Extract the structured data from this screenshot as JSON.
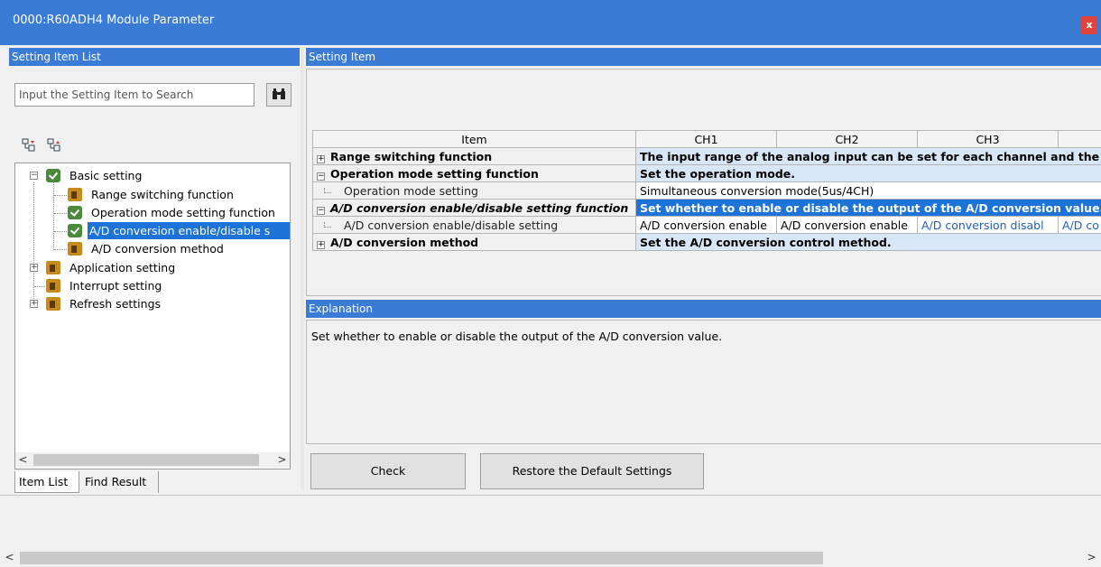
{
  "window": {
    "title": "0000:R60ADH4 Module Parameter",
    "close_label": "x"
  },
  "left_pane": {
    "header": "Setting Item List",
    "search_placeholder": "Input the Setting Item to Search",
    "search_icon": "binoculars-icon",
    "toolbar_icons": [
      "expand-all-icon",
      "collapse-all-icon"
    ],
    "tree": [
      {
        "label": "Basic setting",
        "icon": "check-icon",
        "expanded": true,
        "level": 0
      },
      {
        "label": "Range switching function",
        "icon": "module-icon",
        "level": 1
      },
      {
        "label": "Operation mode setting function",
        "icon": "check-icon",
        "level": 1
      },
      {
        "label": "A/D conversion enable/disable s",
        "icon": "check-icon",
        "level": 1,
        "selected": true
      },
      {
        "label": "A/D conversion method",
        "icon": "module-icon",
        "level": 1
      },
      {
        "label": "Application setting",
        "icon": "module-icon",
        "expanded": false,
        "level": 0
      },
      {
        "label": "Interrupt setting",
        "icon": "module-icon",
        "level": 0
      },
      {
        "label": "Refresh settings",
        "icon": "module-icon",
        "expanded": false,
        "level": 0
      }
    ],
    "tabs": [
      "Item List",
      "Find Result"
    ]
  },
  "right_pane": {
    "header": "Setting Item",
    "columns": [
      "Item",
      "CH1",
      "CH2",
      "CH3",
      ""
    ],
    "rows": [
      {
        "type": "group",
        "sign": "+",
        "item": "Range switching function",
        "desc": "The input range of the analog input can be set for each channel and the"
      },
      {
        "type": "group",
        "sign": "−",
        "item": "Operation mode setting function",
        "desc": "Set the operation mode."
      },
      {
        "type": "sub",
        "item": "Operation mode setting",
        "values": [
          "Simultaneous conversion mode(5us/4CH)"
        ]
      },
      {
        "type": "group-selected",
        "sign": "−",
        "item": "A/D conversion enable/disable setting function",
        "desc": "Set whether to enable or disable the output of the A/D conversion value."
      },
      {
        "type": "sub",
        "item": "A/D conversion enable/disable setting",
        "values": [
          "A/D conversion enable",
          "A/D conversion enable",
          "A/D conversion disabl",
          "A/D co"
        ]
      },
      {
        "type": "group",
        "sign": "+",
        "item": "A/D conversion method",
        "desc": "Set the A/D conversion control method."
      }
    ],
    "explanation_header": "Explanation",
    "explanation_text": "Set whether to enable or disable the output of the A/D conversion value."
  },
  "buttons": {
    "check": "Check",
    "restore": "Restore the Default Settings"
  },
  "scroll": {
    "left_arrow": "<",
    "right_arrow": ">"
  },
  "colors": {
    "accent": "#3a7bd5",
    "selection": "#1e73d8",
    "desc_bg": "#d8e7f7",
    "disabled_text": "#1e5fc4"
  }
}
